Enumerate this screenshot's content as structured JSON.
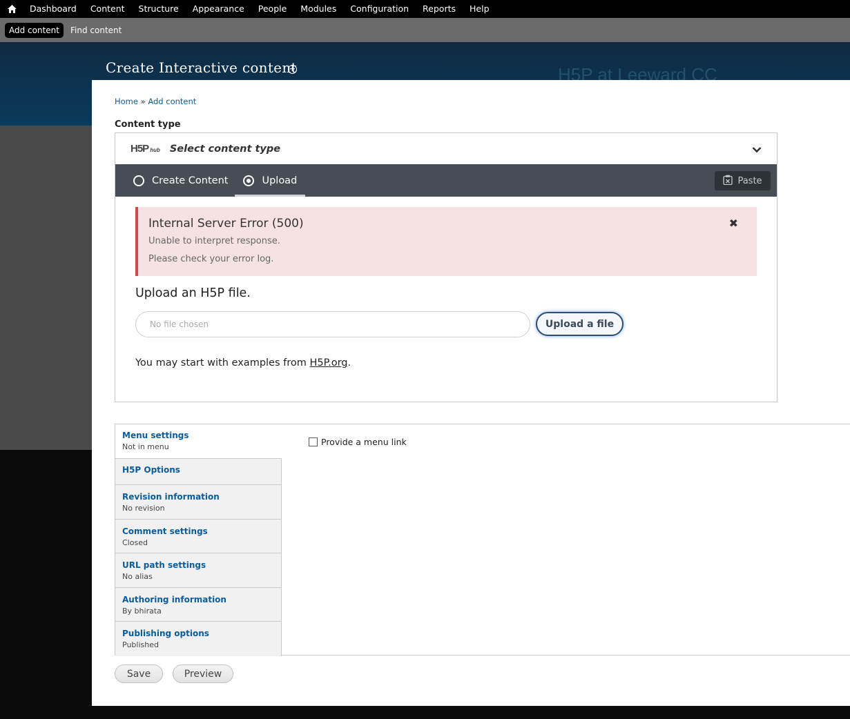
{
  "toolbar": {
    "items": [
      "Dashboard",
      "Content",
      "Structure",
      "Appearance",
      "People",
      "Modules",
      "Configuration",
      "Reports",
      "Help"
    ]
  },
  "shortcuts": {
    "add_content": "Add content",
    "find_content": "Find content"
  },
  "header": {
    "title": "Create Interactive content",
    "site_name": "H5P at Leeward CC"
  },
  "breadcrumb": {
    "home": "Home",
    "separator": "»",
    "add_content": "Add content"
  },
  "content_type": {
    "label": "Content type",
    "hub_logo": "H5P",
    "hub_logo_sub": "hub",
    "select_label": "Select content type"
  },
  "tabs": {
    "create": "Create Content",
    "upload": "Upload",
    "selected": "Upload",
    "paste": "Paste"
  },
  "alert": {
    "title": "Internal Server Error (500)",
    "line1": "Unable to interpret response.",
    "line2": "Please check your error log.",
    "color": "#d14848"
  },
  "upload": {
    "heading": "Upload an H5P file.",
    "file_placeholder": "No file chosen",
    "button": "Upload a file",
    "examples_prefix": "You may start with examples from ",
    "examples_link": "H5P.org",
    "examples_suffix": "."
  },
  "vertical_tabs": [
    {
      "title": "Menu settings",
      "summary": "Not in menu"
    },
    {
      "title": "H5P Options",
      "summary": ""
    },
    {
      "title": "Revision information",
      "summary": "No revision"
    },
    {
      "title": "Comment settings",
      "summary": "Closed"
    },
    {
      "title": "URL path settings",
      "summary": "No alias"
    },
    {
      "title": "Authoring information",
      "summary": "By bhirata"
    },
    {
      "title": "Publishing options",
      "summary": "Published"
    }
  ],
  "menu_link": {
    "label": "Provide a menu link",
    "checked": false
  },
  "actions": {
    "save": "Save",
    "preview": "Preview"
  }
}
